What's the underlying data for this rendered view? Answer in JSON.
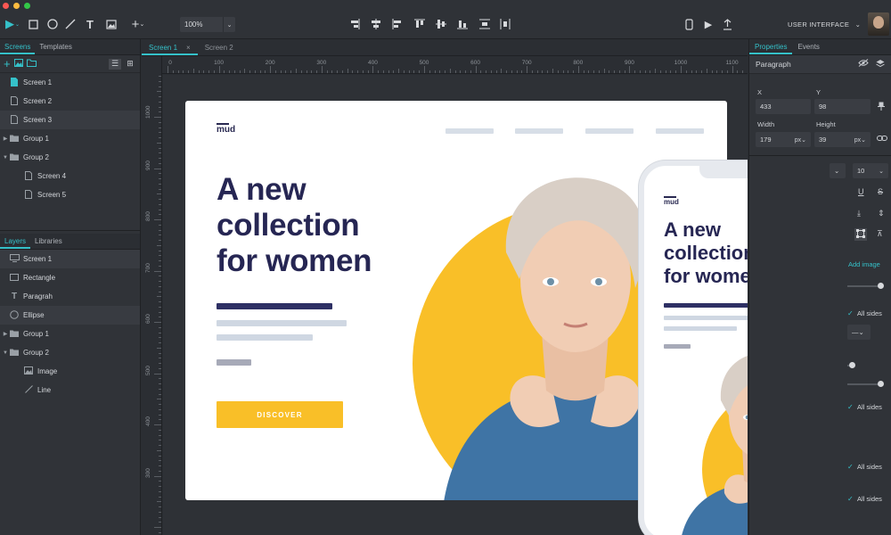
{
  "toolbar": {
    "zoom": "100%",
    "project_label": "USER INTERFACE",
    "traffic_colors": [
      "#fc5753",
      "#fdbc40",
      "#33c748"
    ],
    "accent": "#35c1c9"
  },
  "left_panel": {
    "top_tabs": [
      "Screens",
      "Templates"
    ],
    "screens": [
      {
        "label": "Screen 1",
        "icon": "page-icon",
        "depth": 0,
        "selected": false,
        "type": "screen"
      },
      {
        "label": "Screen 2",
        "icon": "page-icon",
        "depth": 0,
        "selected": false,
        "type": "screen"
      },
      {
        "label": "Screen 3",
        "icon": "page-icon",
        "depth": 0,
        "selected": true,
        "type": "screen"
      },
      {
        "label": "Group 1",
        "icon": "folder-icon",
        "depth": 0,
        "selected": false,
        "type": "group",
        "expanded": false
      },
      {
        "label": "Group 2",
        "icon": "folder-icon",
        "depth": 0,
        "selected": false,
        "type": "group",
        "expanded": true
      },
      {
        "label": "Screen 4",
        "icon": "page-icon",
        "depth": 1,
        "selected": false,
        "type": "screen"
      },
      {
        "label": "Screen 5",
        "icon": "page-icon",
        "depth": 1,
        "selected": false,
        "type": "screen"
      }
    ],
    "bottom_tabs": [
      "Layers",
      "Libraries"
    ],
    "layers": [
      {
        "label": "Screen 1",
        "icon": "monitor-icon",
        "depth": 0,
        "selected": true,
        "type": "screen"
      },
      {
        "label": "Rectangle",
        "icon": "rectangle-icon",
        "depth": 0,
        "selected": false,
        "type": "shape"
      },
      {
        "label": "Paragrah",
        "icon": "text-icon",
        "depth": 0,
        "selected": false,
        "type": "text"
      },
      {
        "label": "Ellipse",
        "icon": "ellipse-icon",
        "depth": 0,
        "selected": true,
        "type": "shape"
      },
      {
        "label": "Group 1",
        "icon": "folder-icon",
        "depth": 0,
        "selected": false,
        "type": "group",
        "expanded": false
      },
      {
        "label": "Group 2",
        "icon": "folder-icon",
        "depth": 0,
        "selected": false,
        "type": "group",
        "expanded": true
      },
      {
        "label": "Image",
        "icon": "image-icon",
        "depth": 1,
        "selected": false,
        "type": "image"
      },
      {
        "label": "Line",
        "icon": "line-icon",
        "depth": 1,
        "selected": false,
        "type": "line"
      }
    ]
  },
  "doc_tabs": [
    {
      "label": "Screen 1",
      "active": true,
      "closable": true
    },
    {
      "label": "Screen 2",
      "active": false,
      "closable": false
    }
  ],
  "ruler": {
    "h_labels": [
      "0",
      "100",
      "200",
      "300",
      "400",
      "500",
      "600",
      "700",
      "800",
      "900",
      "1000",
      "1100"
    ],
    "v_labels": [
      "1000",
      "900",
      "800",
      "700",
      "600",
      "500",
      "400",
      "300"
    ]
  },
  "mockup": {
    "logo": "mud",
    "headline": [
      "A new",
      "collection",
      "for women"
    ],
    "cta": "DISCOVER",
    "colors": {
      "navy": "#262653",
      "yellow": "#f9bf28",
      "light_bar": "#d7dee7",
      "gray_bar": "#a7aab8",
      "skin": "#f1cdb4",
      "sweater": "#3f74a5",
      "hair": "#d9cfc6"
    }
  },
  "right_panel": {
    "tabs": [
      "Properties",
      "Events"
    ],
    "section": "Paragraph",
    "x_label": "X",
    "y_label": "Y",
    "x_value": "433",
    "y_value": "98",
    "width_label": "Width",
    "height_label": "Height",
    "width_value": "179",
    "height_value": "39",
    "unit": "px",
    "font_size": "10",
    "add_image": "Add image",
    "all_sides": [
      "All sides",
      "All sides",
      "All sides",
      "All sides"
    ]
  }
}
